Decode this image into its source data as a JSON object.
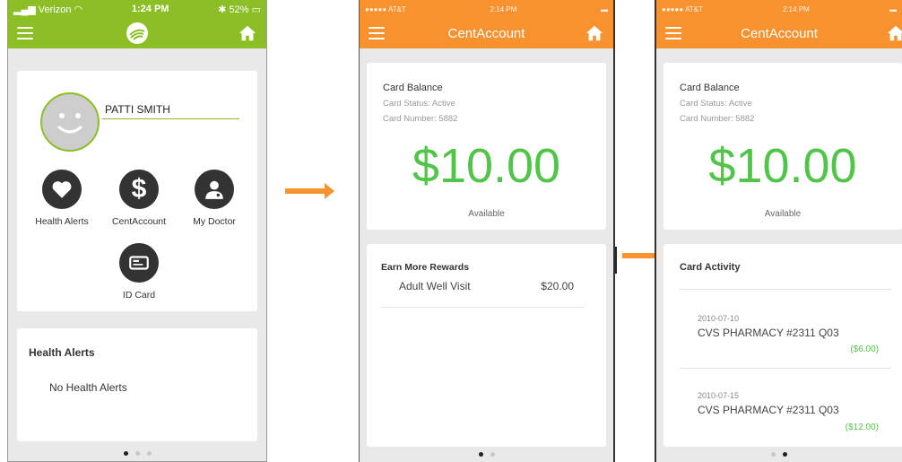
{
  "screen1": {
    "status": {
      "carrier": "Verizon",
      "time": "1:24 PM",
      "battery": "52%"
    },
    "profile": {
      "name": "PATTI SMITH"
    },
    "buttons": [
      {
        "label": "Health Alerts",
        "icon": "heart-icon"
      },
      {
        "label": "CentAccount",
        "icon": "dollar-icon"
      },
      {
        "label": "My Doctor",
        "icon": "doctor-icon"
      },
      {
        "label": "ID Card",
        "icon": "id-card-icon"
      }
    ],
    "alerts": {
      "title": "Health Alerts",
      "empty_text": "No Health Alerts"
    },
    "page_indicator": {
      "count": 3,
      "active": 0
    },
    "colors": {
      "header": "#8cbf26"
    }
  },
  "screen2": {
    "status": {
      "carrier": "AT&T",
      "time": "2:14 PM"
    },
    "title": "CentAccount",
    "balance": {
      "title": "Card Balance",
      "status": "Card Status: Active",
      "number": "Card Number: 5882",
      "amount": "$10.00",
      "available": "Available"
    },
    "rewards": {
      "title": "Earn More Rewards",
      "items": [
        {
          "name": "Adult Well Visit",
          "value": "$20.00"
        }
      ]
    },
    "page_indicator": {
      "count": 2,
      "active": 0
    },
    "colors": {
      "header": "#f7922f",
      "amount": "#52c44a"
    }
  },
  "screen3": {
    "status": {
      "carrier": "AT&T",
      "time": "2:14 PM"
    },
    "title": "CentAccount",
    "balance": {
      "title": "Card Balance",
      "status": "Card Status: Active",
      "number": "Card Number: 5882",
      "amount": "$10.00",
      "available": "Available"
    },
    "activity": {
      "title": "Card Activity",
      "items": [
        {
          "date": "2010-07-10",
          "merchant": "CVS PHARMACY #2311 Q03",
          "amount": "($6.00)"
        },
        {
          "date": "2010-07-15",
          "merchant": "CVS PHARMACY #2311 Q03",
          "amount": "($12.00)"
        }
      ]
    },
    "page_indicator": {
      "count": 2,
      "active": 1
    }
  },
  "flow": {
    "arrow_color": "#f7922f"
  }
}
